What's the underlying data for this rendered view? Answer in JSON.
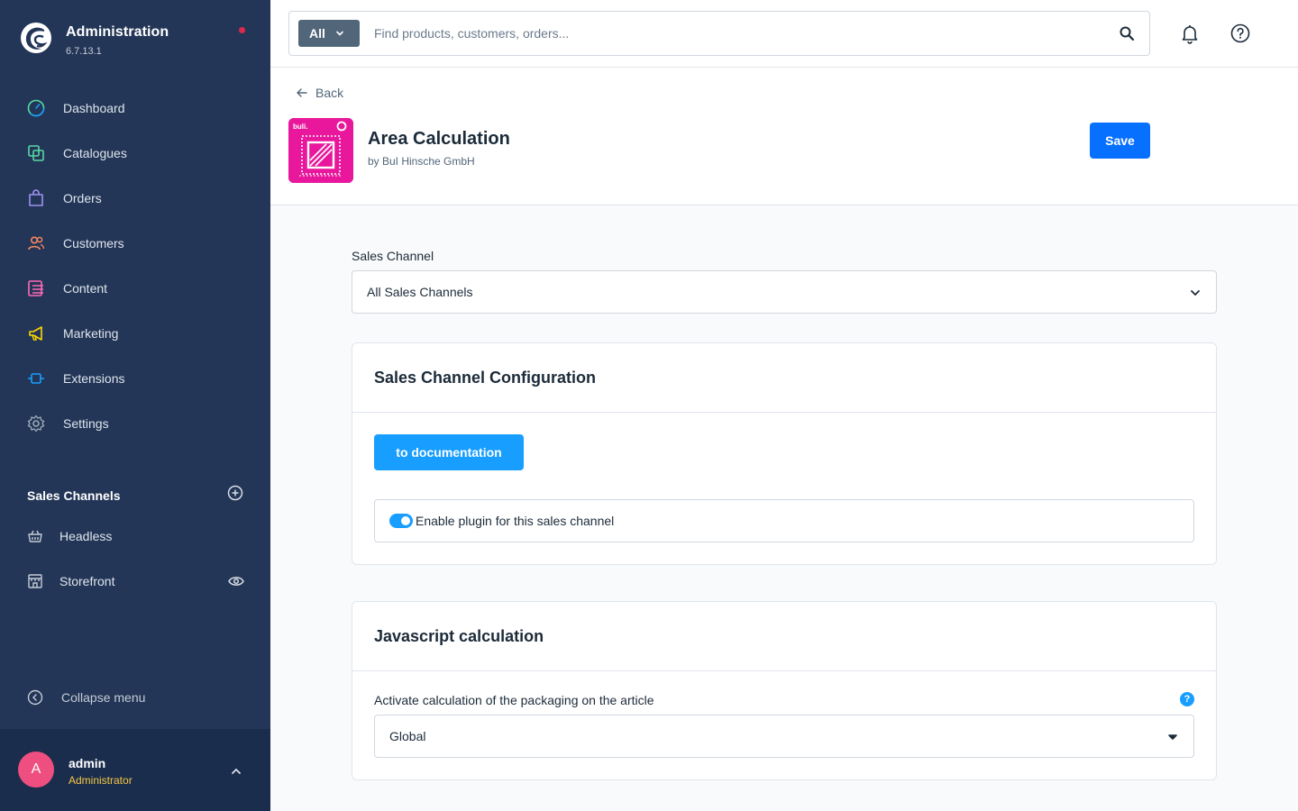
{
  "brand": {
    "title": "Administration",
    "version": "6.7.13.1"
  },
  "nav": [
    {
      "label": "Dashboard",
      "icon": "dashboard-icon",
      "color": "#57d9a3"
    },
    {
      "label": "Catalogues",
      "icon": "catalogues-icon",
      "color": "#57d9a3"
    },
    {
      "label": "Orders",
      "icon": "orders-icon",
      "color": "#a092f0"
    },
    {
      "label": "Customers",
      "icon": "customers-icon",
      "color": "#f88962"
    },
    {
      "label": "Content",
      "icon": "content-icon",
      "color": "#ff68b4"
    },
    {
      "label": "Marketing",
      "icon": "marketing-icon",
      "color": "#ffd700"
    },
    {
      "label": "Extensions",
      "icon": "extensions-icon",
      "color": "#189eff"
    },
    {
      "label": "Settings",
      "icon": "settings-icon",
      "color": "#9aa8b5"
    }
  ],
  "sales_channels": {
    "title": "Sales Channels",
    "items": [
      {
        "label": "Headless",
        "icon": "basket-icon"
      },
      {
        "label": "Storefront",
        "icon": "storefront-icon"
      }
    ]
  },
  "collapse_label": "Collapse menu",
  "user": {
    "initial": "A",
    "name": "admin",
    "role": "Administrator"
  },
  "search": {
    "type_label": "All",
    "placeholder": "Find products, customers, orders..."
  },
  "header": {
    "back_label": "Back",
    "plugin_title": "Area Calculation",
    "plugin_vendor": "by BuI Hinsche GmbH",
    "plugin_icon_text": "buli.",
    "save_label": "Save"
  },
  "sales_channel_field": {
    "label": "Sales Channel",
    "value": "All Sales Channels"
  },
  "config_card": {
    "title": "Sales Channel Configuration",
    "doc_button": "to documentation",
    "toggle_label": "Enable plugin for this sales channel",
    "toggle_on": true
  },
  "js_card": {
    "title": "Javascript calculation",
    "field_label": "Activate calculation of the packaging on the article",
    "help_icon": "?",
    "value": "Global"
  },
  "colors": {
    "sidebar": "#233657",
    "user_panel": "#1b2d4d",
    "primary": "#0870ff",
    "accent": "#189eff",
    "plugin_icon": "#e8179b",
    "avatar": "#ef4f80",
    "role": "#f5c842"
  }
}
